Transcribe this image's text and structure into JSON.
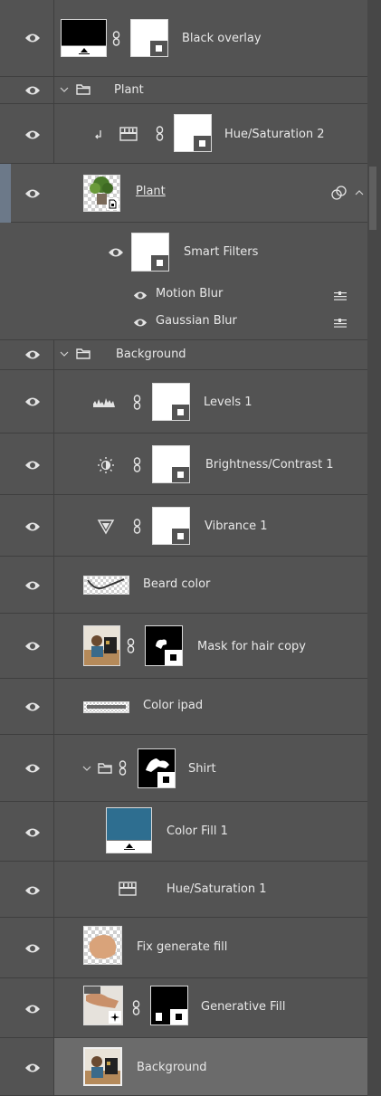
{
  "layers": {
    "black_overlay": "Black overlay",
    "plant_group": "Plant",
    "hue_sat_2": "Hue/Saturation 2",
    "plant": "Plant",
    "smart_filters": "Smart Filters",
    "motion_blur": "Motion Blur",
    "gaussian_blur": "Gaussian Blur",
    "background_group": "Background",
    "levels_1": "Levels 1",
    "brightness_contrast_1": "Brightness/Contrast 1",
    "vibrance_1": "Vibrance 1",
    "beard_color": "Beard color",
    "mask_hair_copy": "Mask for hair copy",
    "color_ipad": "Color ipad",
    "shirt": "Shirt",
    "color_fill_1": "Color Fill 1",
    "hue_sat_1": "Hue/Saturation 1",
    "fix_generate_fill": "Fix generate fill",
    "generative_fill": "Generative Fill",
    "background": "Background"
  },
  "colors": {
    "panel_bg": "#535353",
    "selected_row": "#6b6b6b",
    "color_fill_swatch": "#2e6e90",
    "overlay_swatch": "#000000"
  },
  "icons": {
    "visibility": "eye-icon",
    "link": "chain-link-icon",
    "folder": "folder-icon",
    "expand": "chevron-down-icon",
    "clip": "clipping-arrow-icon",
    "smart_object": "smart-object-icon",
    "filter_options": "filter-blend-options-icon"
  }
}
